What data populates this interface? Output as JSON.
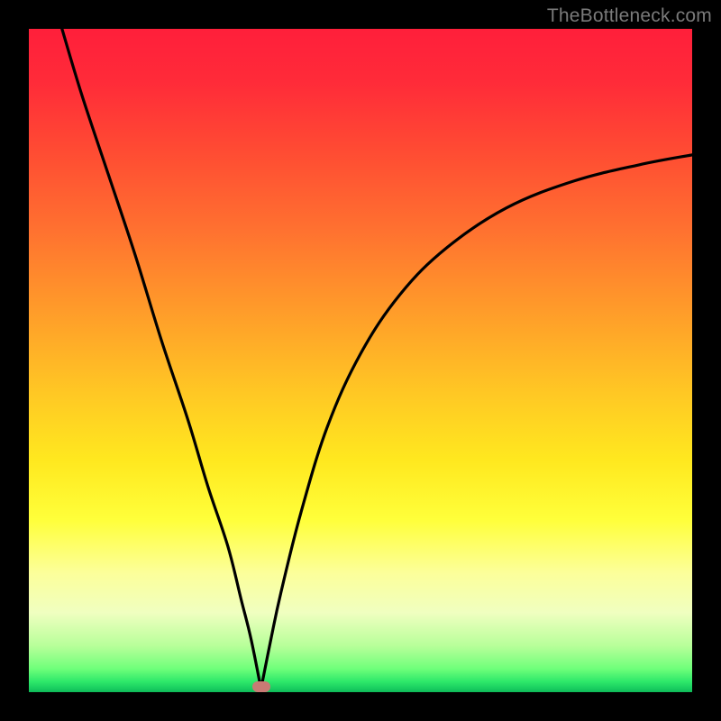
{
  "watermark": "TheBottleneck.com",
  "marker": {
    "x_pct": 35.0,
    "y_pct": 99.2
  },
  "chart_data": {
    "type": "line",
    "title": "",
    "xlabel": "",
    "ylabel": "",
    "xlim": [
      0,
      100
    ],
    "ylim": [
      0,
      100
    ],
    "series": [
      {
        "name": "curve",
        "x": [
          5,
          8,
          12,
          16,
          20,
          24,
          27,
          30,
          32,
          33.5,
          35,
          36.5,
          38,
          41,
          45,
          50,
          56,
          63,
          72,
          82,
          92,
          100
        ],
        "y": [
          100,
          90,
          78,
          66,
          53,
          41,
          31,
          22,
          14,
          8,
          0.5,
          8,
          15,
          27,
          40,
          51,
          60,
          67,
          73,
          77,
          79.5,
          81
        ]
      }
    ],
    "gradient_stops": [
      {
        "pct": 0,
        "color": "#FF1F3A"
      },
      {
        "pct": 18,
        "color": "#FF4A33"
      },
      {
        "pct": 42,
        "color": "#FF9A2A"
      },
      {
        "pct": 65,
        "color": "#FFE81F"
      },
      {
        "pct": 82,
        "color": "#FCFF9A"
      },
      {
        "pct": 93,
        "color": "#B8FF9A"
      },
      {
        "pct": 99,
        "color": "#15C95E"
      },
      {
        "pct": 100,
        "color": "#0FB858"
      }
    ],
    "marker": {
      "x": 35,
      "y": 0.8
    }
  }
}
